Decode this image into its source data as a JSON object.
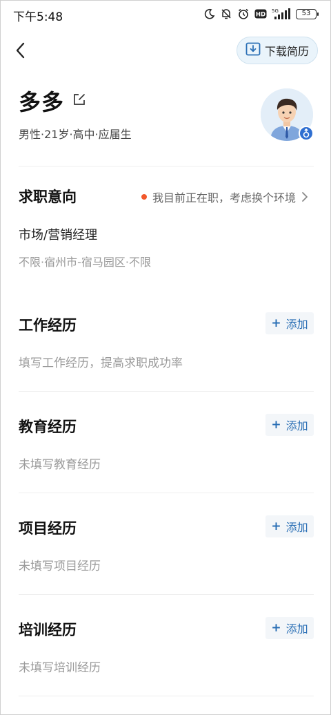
{
  "status_bar": {
    "time": "下午5:48",
    "network": "5G",
    "hd": "HD",
    "battery": "53",
    "icons": [
      "moon-icon",
      "mute-icon",
      "alarm-icon",
      "hd-icon",
      "signal-icon",
      "battery-icon"
    ]
  },
  "header": {
    "back_icon": "chevron-left-icon",
    "download_label": "下载简历",
    "download_icon": "download-icon"
  },
  "profile": {
    "name": "多多",
    "meta": "男性·21岁·高中·应届生",
    "gender": "male-icon"
  },
  "job_intent": {
    "title": "求职意向",
    "status": "我目前正在职，考虑换个环境",
    "status_color": "#f2582b",
    "position": "市场/营销经理",
    "detail": "不限·宿州市-宿马园区·不限"
  },
  "sections": [
    {
      "title": "工作经历",
      "add_label": "添加",
      "placeholder": "填写工作经历，提高求职成功率"
    },
    {
      "title": "教育经历",
      "add_label": "添加",
      "placeholder": "未填写教育经历"
    },
    {
      "title": "项目经历",
      "add_label": "添加",
      "placeholder": "未填写项目经历"
    },
    {
      "title": "培训经历",
      "add_label": "添加",
      "placeholder": "未填写培训经历"
    }
  ],
  "colors": {
    "accent": "#2a6fb5",
    "download_bg": "#eaf4fb",
    "add_bg": "#f3f6f9"
  }
}
